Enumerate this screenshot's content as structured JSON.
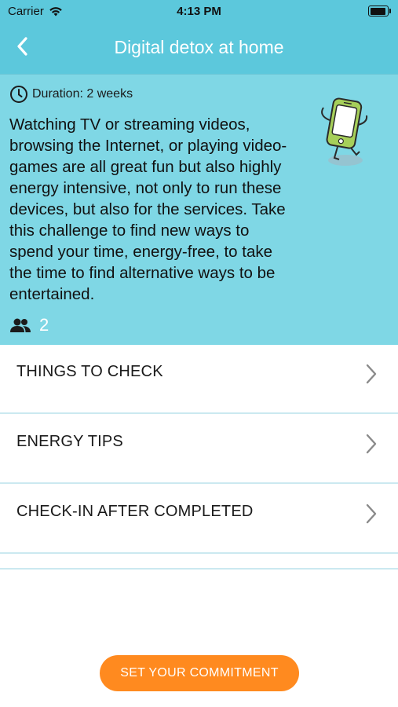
{
  "status_bar": {
    "carrier": "Carrier",
    "time": "4:13 PM"
  },
  "nav": {
    "title": "Digital detox at home",
    "back_icon": "chevron-left-icon"
  },
  "challenge": {
    "duration": "Duration: 2 weeks",
    "description": "Watching TV or streaming videos, browsing the Internet, or playing video-games are all great fun but also highly energy intensive, not only to run these devices, but also for the services. Take this challenge to find new ways to spend your time, energy-free, to take the time to find alternative ways to be entertained.",
    "participants_count": "2",
    "participants_icon": "people-icon",
    "illustration": "smartphone-mascot"
  },
  "sections": [
    {
      "label": "THINGS TO CHECK"
    },
    {
      "label": "ENERGY TIPS"
    },
    {
      "label": "CHECK-IN AFTER COMPLETED"
    }
  ],
  "commit_button": {
    "label": "SET YOUR COMMITMENT"
  },
  "colors": {
    "nav_bg": "#5cc8dc",
    "hero_bg": "#7fd7e5",
    "accent": "#ff8a1f",
    "divider": "#cbe9f0"
  }
}
